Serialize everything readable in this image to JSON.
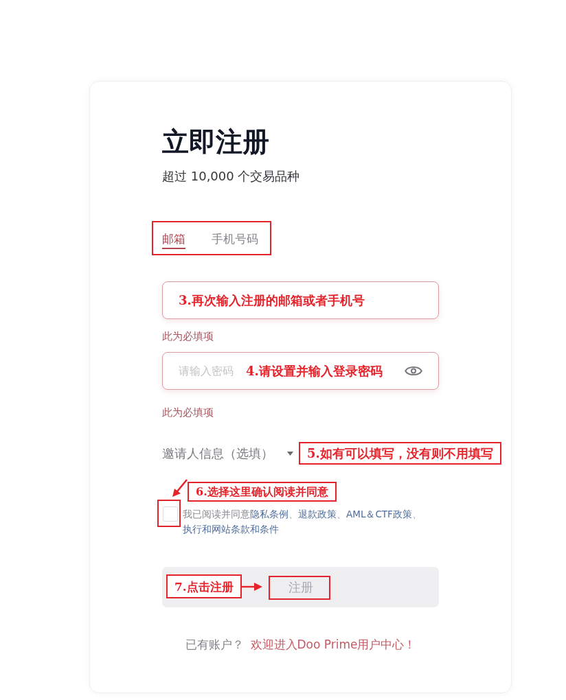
{
  "title": "立即注册",
  "subtitle": "超过 10,000 个交易品种",
  "tab_bar": {
    "outlined": true,
    "tabs": [
      {
        "label": "邮箱",
        "selected": true
      },
      {
        "label": "手机号码",
        "selected": false
      }
    ]
  },
  "fields": [
    {
      "kind": "text",
      "invalid": true,
      "note": {
        "text": "3.再次输入注册的邮箱或者手机号",
        "boxed": false
      },
      "error": "此为必填项"
    },
    {
      "kind": "password",
      "invalid": true,
      "placeholder": "请输入密码",
      "note": {
        "text": "4.请设置并输入登录密码",
        "boxed": false
      },
      "error": "此为必填项"
    }
  ],
  "invite": {
    "label": "邀请人信息（选填）",
    "expanded": false,
    "note": {
      "text": "5.如有可以填写，没有则不用填写",
      "boxed": true
    }
  },
  "agreement": {
    "checked": false,
    "outlined": true,
    "note": {
      "text": "6.选择这里确认阅读并同意",
      "boxed": true,
      "arrow": true
    },
    "parts": [
      {
        "kind": "plain",
        "text": "我已阅读并同意"
      },
      {
        "kind": "link",
        "text": "隐私条例"
      },
      {
        "kind": "plain",
        "text": "、"
      },
      {
        "kind": "link",
        "text": "退款政策"
      },
      {
        "kind": "plain",
        "text": "、"
      },
      {
        "kind": "link",
        "text": "AML＆CTF政策"
      },
      {
        "kind": "plain",
        "text": "、"
      },
      {
        "kind": "link",
        "text": "执行和网站条款和条件"
      }
    ]
  },
  "submit": {
    "label": "注册",
    "disabled": true,
    "outlined": true,
    "note": {
      "text": "7.点击注册",
      "boxed": true,
      "arrow": true
    }
  },
  "footer": {
    "prompt": "已有账户？",
    "link": "欢迎进入Doo Prime用户中心！"
  }
}
